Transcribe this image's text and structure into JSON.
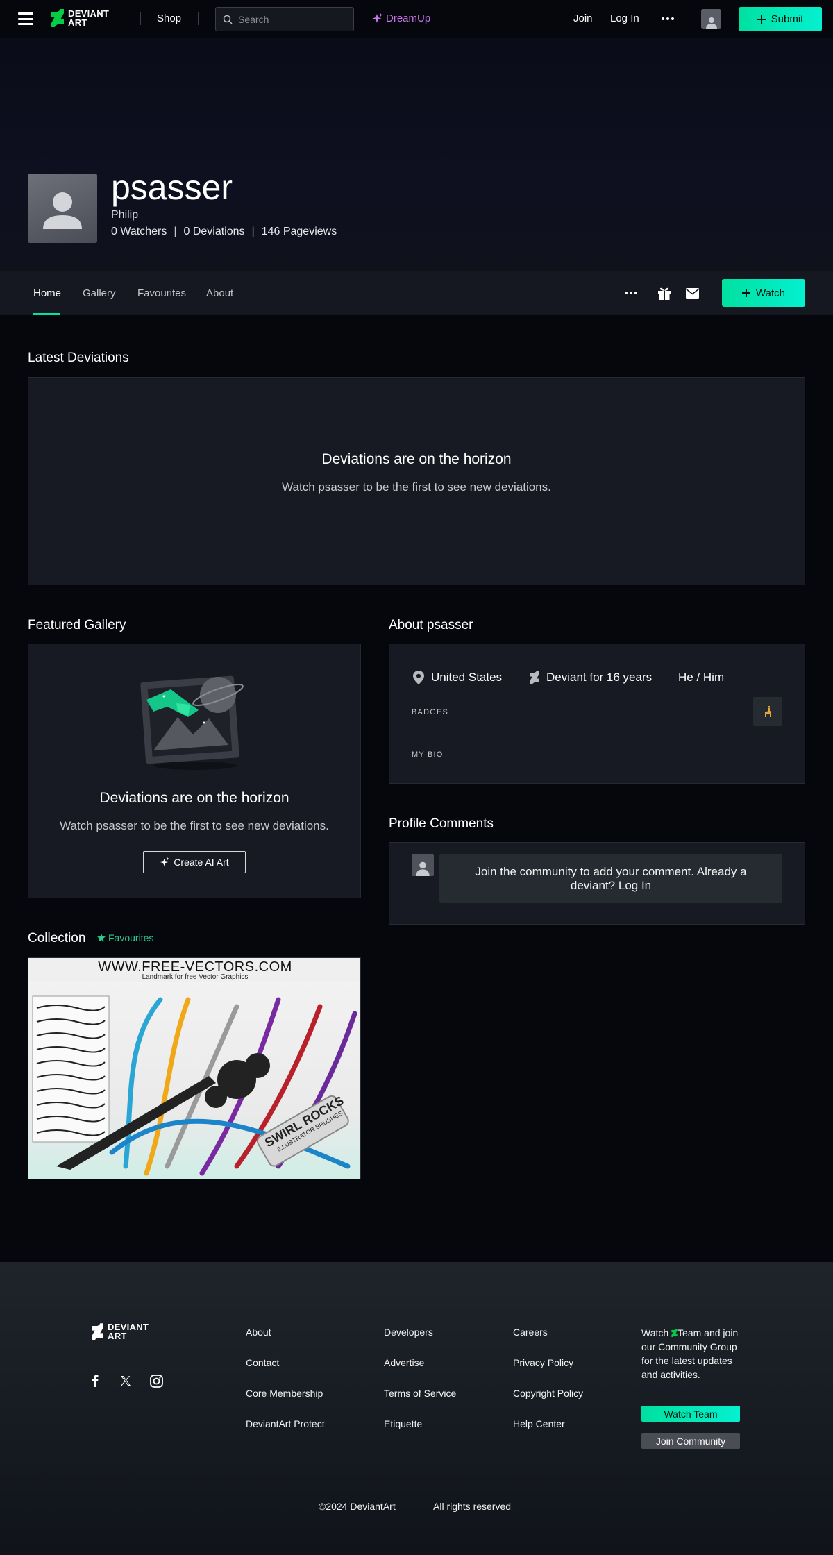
{
  "nav": {
    "shop": "Shop",
    "search_placeholder": "Search",
    "dreamup": "DreamUp",
    "join": "Join",
    "login": "Log In",
    "submit": "Submit"
  },
  "brand": {
    "line1": "DEVIANT",
    "line2": "ART"
  },
  "profile": {
    "username": "psasser",
    "realname": "Philip",
    "watchers": "0 Watchers",
    "deviations": "0 Deviations",
    "pageviews": "146 Pageviews"
  },
  "tabs": [
    {
      "label": "Home",
      "active": true
    },
    {
      "label": "Gallery",
      "active": false
    },
    {
      "label": "Favourites",
      "active": false
    },
    {
      "label": "About",
      "active": false
    }
  ],
  "watch_button": "Watch",
  "latest": {
    "title": "Latest Deviations",
    "empty_heading": "Deviations are on the horizon",
    "empty_sub": "Watch psasser to be the first to see new deviations."
  },
  "featured": {
    "title": "Featured Gallery",
    "empty_heading": "Deviations are on the horizon",
    "empty_sub": "Watch psasser to be the first to see new deviations.",
    "create_button": "Create AI Art"
  },
  "about": {
    "title": "About psasser",
    "location": "United States",
    "tenure": "Deviant for 16 years",
    "pronouns": "He / Him",
    "badges_label": "BADGES",
    "bio_label": "MY BIO"
  },
  "comments": {
    "title": "Profile Comments",
    "prompt_prefix": "Join the community to add your comment. Already a deviant? ",
    "login_link": "Log In"
  },
  "collection": {
    "title": "Collection",
    "favourites_tag": "Favourites",
    "thumb_header": "WWW.FREE-VECTORS.COM",
    "thumb_subheader": "Landmark for free Vector Graphics",
    "thumb_badge_line1": "SWIRL ROCKS",
    "thumb_badge_line2": "ILLUSTRATOR BRUSHES"
  },
  "footer": {
    "col1": [
      "About",
      "Contact",
      "Core Membership",
      "DeviantArt Protect"
    ],
    "col2": [
      "Developers",
      "Advertise",
      "Terms of Service",
      "Etiquette"
    ],
    "col3": [
      "Careers",
      "Privacy Policy",
      "Copyright Policy",
      "Help Center"
    ],
    "watch_text_prefix": "Watch",
    "watch_text_suffix": "Team and join our Community Group for the latest updates and activities.",
    "watch_team_button": "Watch Team",
    "join_community_button": "Join Community",
    "copyright": "©2024 DeviantArt",
    "rights": "All rights reserved"
  },
  "colors": {
    "accent_green": "#00e59b",
    "dreamup_purple": "#c977ea",
    "panel_bg": "#171a22",
    "page_bg": "#06070d"
  },
  "icons": {
    "menu": "hamburger-icon",
    "search": "search-icon",
    "dreamup": "sparkle-icon",
    "more": "more-dots-icon",
    "user": "user-icon",
    "plus": "plus-icon",
    "gift": "gift-icon",
    "mail": "mail-icon",
    "location": "location-pin-icon",
    "deviant": "deviantart-logo-icon",
    "badge": "llama-badge-icon",
    "star": "star-icon",
    "facebook": "facebook-icon",
    "x": "x-icon",
    "instagram": "instagram-icon"
  }
}
